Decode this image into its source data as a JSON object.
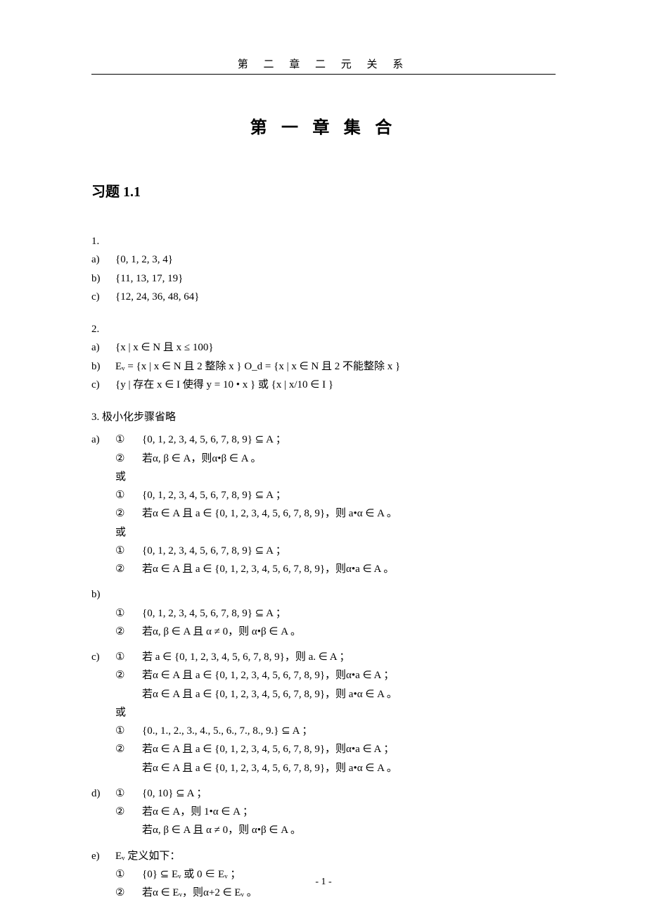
{
  "running_head": "第  二  章      二  元  关  系",
  "chapter_title": "第  一  章    集  合",
  "section_title": "习题 1.1",
  "q1": {
    "num": "1.",
    "a_label": "a)",
    "a": "{0, 1, 2, 3, 4}",
    "b_label": "b)",
    "b": "{11, 13, 17, 19}",
    "c_label": "c)",
    "c": "{12, 24, 36, 48, 64}"
  },
  "q2": {
    "num": "2.",
    "a_label": "a)",
    "a": "{x | x ∈ N  且 x ≤ 100}",
    "b_label": "b)",
    "b": "Eᵥ = {x | x ∈ N  且 2 整除 x }           O_d = {x | x ∈ N  且 2 不能整除 x }",
    "c_label": "c)",
    "c": "{y |  存在 x ∈ I  使得  y = 10 • x }  或  {x | x/10 ∈ I }"
  },
  "q3": {
    "num": "3.  极小化步骤省略",
    "or": "或",
    "a": {
      "label": "a)",
      "r1_n": "①",
      "r1": "{0, 1, 2, 3, 4, 5, 6, 7, 8, 9} ⊆ A  ；",
      "r2_n": "②",
      "r2": "若α, β ∈ A，则α•β ∈ A  。",
      "r3_n": "①",
      "r3": "{0, 1, 2, 3, 4, 5, 6, 7, 8, 9} ⊆ A  ；",
      "r4_n": "②",
      "r4": "若α ∈ A  且  a ∈ {0, 1, 2, 3, 4, 5, 6, 7, 8, 9}，则 a•α ∈ A  。",
      "r5_n": "①",
      "r5": "{0, 1, 2, 3, 4, 5, 6, 7, 8, 9} ⊆ A  ；",
      "r6_n": "②",
      "r6": "若α ∈ A  且  a ∈ {0, 1, 2, 3, 4, 5, 6, 7, 8, 9}，则α•a ∈ A  。"
    },
    "b": {
      "label": "b)",
      "r1_n": "①",
      "r1": "{0, 1, 2, 3, 4, 5, 6, 7, 8, 9} ⊆ A  ；",
      "r2_n": "②",
      "r2": "若α, β ∈ A  且  α ≠ 0，则  α•β ∈ A  。"
    },
    "c": {
      "label": "c)",
      "r1_n": "①",
      "r1": "若 a ∈ {0, 1, 2, 3, 4, 5, 6, 7, 8, 9}，则  a. ∈ A  ；",
      "r2_n": "②",
      "r2": "若α ∈ A  且  a ∈ {0, 1, 2, 3, 4, 5, 6, 7, 8, 9}，则α•a ∈ A  ；",
      "r3": "若α ∈ A  且  a ∈ {0, 1, 2, 3, 4, 5, 6, 7, 8, 9}，则 a•α ∈ A  。",
      "r4_n": "①",
      "r4": "{0., 1., 2., 3., 4., 5., 6., 7., 8., 9.} ⊆ A  ；",
      "r5_n": "②",
      "r5": "若α ∈ A  且  a ∈ {0, 1, 2, 3, 4, 5, 6, 7, 8, 9}，则α•a ∈ A  ；",
      "r6": "若α ∈ A  且  a ∈ {0, 1, 2, 3, 4, 5, 6, 7, 8, 9}，则 a•α ∈ A  。"
    },
    "d": {
      "label": "d)",
      "r1_n": "①",
      "r1": "{0, 10} ⊆ A  ；",
      "r2_n": "②",
      "r2": "若α ∈ A，则 1•α ∈ A  ；",
      "r3": "若α, β ∈ A  且  α ≠ 0，则  α•β ∈ A  。"
    },
    "e": {
      "label": "e)",
      "intro": "Eᵥ 定义如下：",
      "r1_n": "①",
      "r1": "{0} ⊆ Eᵥ  或 0 ∈ Eᵥ ；",
      "r2_n": "②",
      "r2": "若α ∈ Eᵥ，则α+2 ∈ Eᵥ 。"
    }
  },
  "page_number": "- 1 -"
}
